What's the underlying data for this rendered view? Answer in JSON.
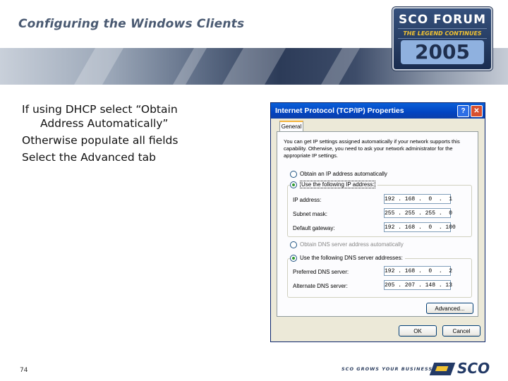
{
  "slide": {
    "title": "Configuring the Windows Clients",
    "bullets": [
      {
        "line1": "If using DHCP select “Obtain",
        "line2": "Address Automatically”"
      },
      {
        "line1": "Otherwise populate all fields",
        "line2": ""
      },
      {
        "line1": "Select the Advanced tab",
        "line2": ""
      }
    ],
    "page_number": "74",
    "footer_tagline": "SCO GROWS YOUR BUSINESS",
    "footer_logo_text": "SCO"
  },
  "logo": {
    "line1": "SCO FORUM",
    "line2": "THE LEGEND CONTINUES",
    "line3": "2005"
  },
  "dialog": {
    "title": "Internet Protocol (TCP/IP) Properties",
    "help_glyph": "?",
    "close_glyph": "✕",
    "tab_label": "General",
    "intro_text": "You can get IP settings assigned automatically if your network supports this capability. Otherwise, you need to ask your network administrator for the appropriate IP settings.",
    "ip_obtain_auto_label": "Obtain an IP address automatically",
    "ip_use_following_label": "Use the following IP address:",
    "ip_address_label": "IP address:",
    "ip_address_value": "192 . 168 .  0  .  1",
    "subnet_label": "Subnet mask:",
    "subnet_value": "255 . 255 . 255 .  0",
    "gateway_label": "Default gateway:",
    "gateway_value": "192 . 168 .  0  . 100",
    "dns_obtain_auto_label": "Obtain DNS server address automatically",
    "dns_use_following_label": "Use the following DNS server addresses:",
    "preferred_dns_label": "Preferred DNS server:",
    "preferred_dns_value": "192 . 168 .  0  .  2",
    "alternate_dns_label": "Alternate DNS server:",
    "alternate_dns_value": "205 . 207 . 148 . 13",
    "advanced_button": "Advanced...",
    "ok_button": "OK",
    "cancel_button": "Cancel"
  },
  "colors": {
    "titlebar": "#0244c2",
    "dialog_bg": "#ece9d8",
    "slide_title": "#4a5a72"
  }
}
